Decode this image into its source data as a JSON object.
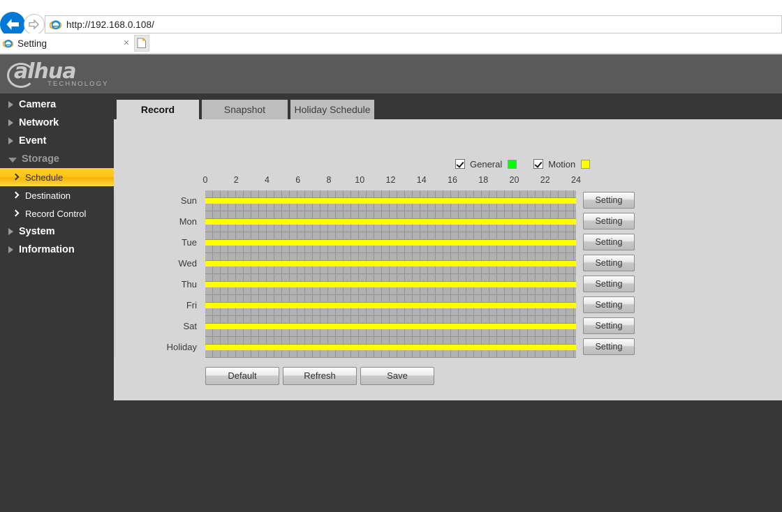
{
  "browser": {
    "address": "http://192.168.0.108/",
    "tab_title": "Setting",
    "back_icon": "back-arrow-icon",
    "forward_icon": "forward-arrow-icon",
    "close_icon": "×",
    "new_tab_icon": "new-tab-icon"
  },
  "header": {
    "brand": "alhua",
    "brand_sub": "TECHNOLOGY"
  },
  "sidebar": {
    "items": [
      {
        "label": "Camera",
        "type": "top",
        "expanded": false
      },
      {
        "label": "Network",
        "type": "top",
        "expanded": false
      },
      {
        "label": "Event",
        "type": "top",
        "expanded": false
      },
      {
        "label": "Storage",
        "type": "top",
        "expanded": true
      },
      {
        "label": "Schedule",
        "type": "sub",
        "active": true
      },
      {
        "label": "Destination",
        "type": "sub",
        "active": false
      },
      {
        "label": "Record Control",
        "type": "sub",
        "active": false
      },
      {
        "label": "System",
        "type": "top",
        "expanded": false
      },
      {
        "label": "Information",
        "type": "top",
        "expanded": false
      }
    ]
  },
  "tabs": [
    {
      "label": "Record",
      "active": true
    },
    {
      "label": "Snapshot",
      "active": false
    },
    {
      "label": "Holiday Schedule",
      "active": false
    }
  ],
  "legend": [
    {
      "label": "General",
      "checked": true,
      "color": "#00ff00"
    },
    {
      "label": "Motion",
      "checked": true,
      "color": "#ffff00"
    }
  ],
  "schedule": {
    "time_ticks": [
      "0",
      "2",
      "4",
      "6",
      "8",
      "10",
      "12",
      "14",
      "16",
      "18",
      "20",
      "22",
      "24"
    ],
    "axis_start_hour": 0,
    "axis_end_hour": 24,
    "rows": [
      {
        "day": "Sun",
        "setting_label": "Setting",
        "bar_color": "#ffff00",
        "bar_start_hour": 0,
        "bar_end_hour": 24
      },
      {
        "day": "Mon",
        "setting_label": "Setting",
        "bar_color": "#ffff00",
        "bar_start_hour": 0,
        "bar_end_hour": 24
      },
      {
        "day": "Tue",
        "setting_label": "Setting",
        "bar_color": "#ffff00",
        "bar_start_hour": 0,
        "bar_end_hour": 24
      },
      {
        "day": "Wed",
        "setting_label": "Setting",
        "bar_color": "#ffff00",
        "bar_start_hour": 0,
        "bar_end_hour": 24
      },
      {
        "day": "Thu",
        "setting_label": "Setting",
        "bar_color": "#ffff00",
        "bar_start_hour": 0,
        "bar_end_hour": 24
      },
      {
        "day": "Fri",
        "setting_label": "Setting",
        "bar_color": "#ffff00",
        "bar_start_hour": 0,
        "bar_end_hour": 24
      },
      {
        "day": "Sat",
        "setting_label": "Setting",
        "bar_color": "#ffff00",
        "bar_start_hour": 0,
        "bar_end_hour": 24
      },
      {
        "day": "Holiday",
        "setting_label": "Setting",
        "bar_color": "#ffff00",
        "bar_start_hour": 0,
        "bar_end_hour": 24
      }
    ]
  },
  "actions": {
    "default_label": "Default",
    "refresh_label": "Refresh",
    "save_label": "Save"
  }
}
